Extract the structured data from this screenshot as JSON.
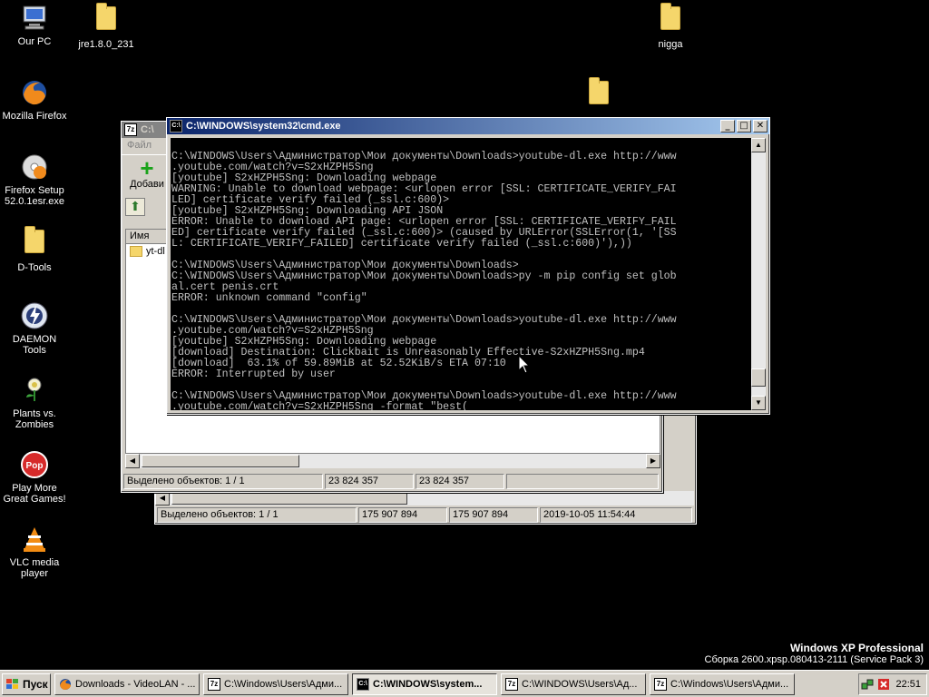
{
  "desktop": {
    "icons": [
      {
        "label": "Our PC",
        "icon": "computer-icon"
      },
      {
        "label": "jre1.8.0_231",
        "icon": "folder-icon"
      },
      {
        "label": "nigga",
        "icon": "folder-icon"
      },
      {
        "label": "Mozilla Firefox",
        "icon": "firefox-icon"
      },
      {
        "label": "Firefox Setup 52.0.1esr.exe",
        "icon": "installer-icon"
      },
      {
        "label": "D-Tools",
        "icon": "folder-icon"
      },
      {
        "label": "DAEMON Tools",
        "icon": "daemon-tools-icon"
      },
      {
        "label": "Plants vs. Zombies",
        "icon": "plants-icon"
      },
      {
        "label": "Play More Great Games!",
        "icon": "popcap-icon"
      },
      {
        "label": "VLC media player",
        "icon": "vlc-icon"
      },
      {
        "label": "",
        "icon": "folder-icon"
      }
    ],
    "os_name": "Windows XP Professional",
    "os_build": "Сборка 2600.xpsp.080413-2111 (Service Pack 3)"
  },
  "zip_back": {
    "status": [
      "Выделено объектов: 1 / 1",
      "175 907 894",
      "175 907 894",
      "2019-10-05 11:54:44"
    ]
  },
  "zip_front": {
    "title": "C:\\",
    "menu_file": "Файл",
    "toolbar_add": "Добави",
    "column_name": "Имя",
    "row_item": "yt-dl",
    "status": [
      "Выделено объектов: 1 / 1",
      "23 824 357",
      "23 824 357"
    ]
  },
  "cmd": {
    "title": "C:\\WINDOWS\\system32\\cmd.exe",
    "lines": [
      "",
      "C:\\WINDOWS\\Users\\Администратор\\Мои документы\\Downloads>youtube-dl.exe http://www",
      ".youtube.com/watch?v=S2xHZPH5Sng",
      "[youtube] S2xHZPH5Sng: Downloading webpage",
      "WARNING: Unable to download webpage: <urlopen error [SSL: CERTIFICATE_VERIFY_FAI",
      "LED] certificate verify failed (_ssl.c:600)>",
      "[youtube] S2xHZPH5Sng: Downloading API JSON",
      "ERROR: Unable to download API page: <urlopen error [SSL: CERTIFICATE_VERIFY_FAIL",
      "ED] certificate verify failed (_ssl.c:600)> (caused by URLError(SSLError(1, '[SS",
      "L: CERTIFICATE_VERIFY_FAILED] certificate verify failed (_ssl.c:600)'),))",
      "",
      "C:\\WINDOWS\\Users\\Администратор\\Мои документы\\Downloads>",
      "C:\\WINDOWS\\Users\\Администратор\\Мои документы\\Downloads>py -m pip config set glob",
      "al.cert penis.crt",
      "ERROR: unknown command \"config\"",
      "",
      "C:\\WINDOWS\\Users\\Администратор\\Мои документы\\Downloads>youtube-dl.exe http://www",
      ".youtube.com/watch?v=S2xHZPH5Sng",
      "[youtube] S2xHZPH5Sng: Downloading webpage",
      "[download] Destination: Clickbait is Unreasonably Effective-S2xHZPH5Sng.mp4",
      "[download]  63.1% of 59.89MiB at 52.52KiB/s ETA 07:10",
      "ERROR: Interrupted by user",
      "",
      "C:\\WINDOWS\\Users\\Администратор\\Мои документы\\Downloads>youtube-dl.exe http://www",
      ".youtube.com/watch?v=S2xHZPH5Sng -format \"best("
    ]
  },
  "taskbar": {
    "start_label": "Пуск",
    "items": [
      {
        "label": "Downloads - VideoLAN - ...",
        "icon": "firefox-icon"
      },
      {
        "label": "C:\\Windows\\Users\\Адми...",
        "icon": "7zip-icon"
      },
      {
        "label": "C:\\WINDOWS\\system...",
        "icon": "cmd-icon"
      },
      {
        "label": "C:\\WINDOWS\\Users\\Ад...",
        "icon": "7zip-icon"
      },
      {
        "label": "C:\\Windows\\Users\\Адми...",
        "icon": "7zip-icon"
      }
    ],
    "clock": "22:51"
  }
}
